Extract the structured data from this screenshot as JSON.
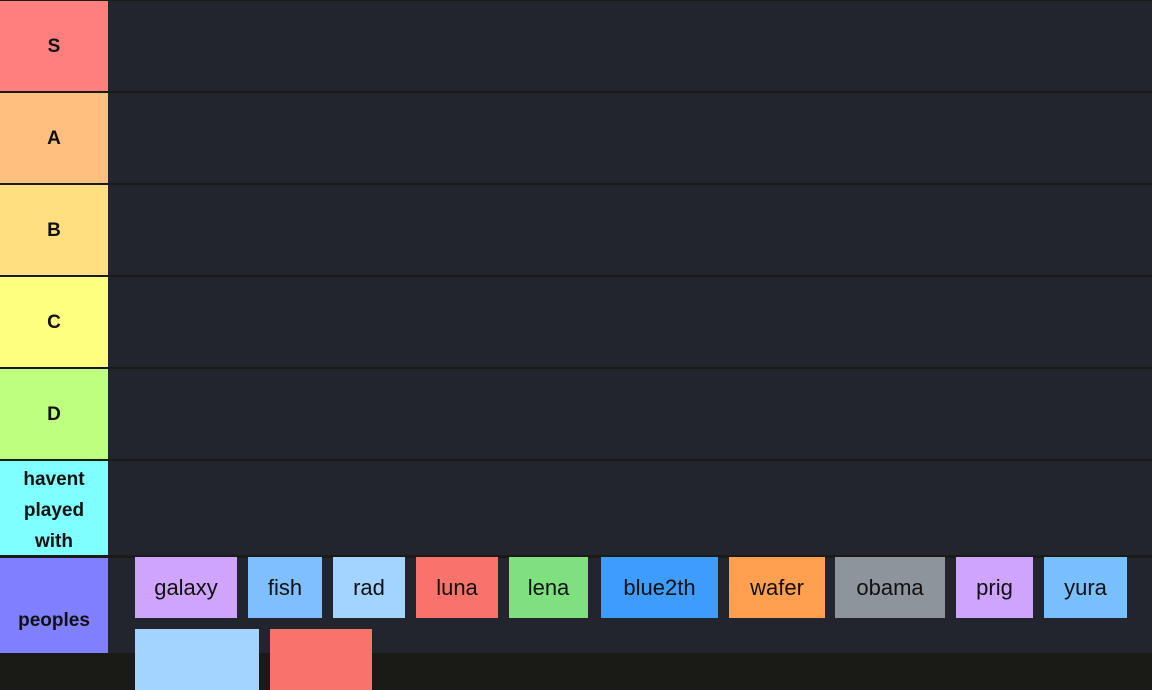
{
  "tiers": [
    {
      "label": "S",
      "color": "#ff7f7e"
    },
    {
      "label": "A",
      "color": "#ffbf7f"
    },
    {
      "label": "B",
      "color": "#ffdf80"
    },
    {
      "label": "C",
      "color": "#feff7f"
    },
    {
      "label": "D",
      "color": "#bfff7f"
    },
    {
      "label": "havent played with",
      "lines": [
        "havent",
        "played",
        "with"
      ],
      "color": "#7fffff"
    },
    {
      "label": "peoples",
      "color": "#7f7fff"
    }
  ],
  "items": [
    {
      "label": "galaxy",
      "color": "#cea4fe"
    },
    {
      "label": "fish",
      "color": "#7fbfff"
    },
    {
      "label": "rad",
      "color": "#a3d3ff"
    },
    {
      "label": "luna",
      "color": "#f9736d"
    },
    {
      "label": "lena",
      "color": "#7fe07f"
    },
    {
      "label": "blue2th",
      "color": "#3f9cff"
    },
    {
      "label": "wafer",
      "color": "#ff9f4f"
    },
    {
      "label": "obama",
      "color": "#8e949b"
    },
    {
      "label": "prig",
      "color": "#cea4fe"
    },
    {
      "label": "yura",
      "color": "#77bfff"
    },
    {
      "label": "",
      "color": "#a3d3ff"
    },
    {
      "label": "",
      "color": "#f9736d"
    }
  ]
}
